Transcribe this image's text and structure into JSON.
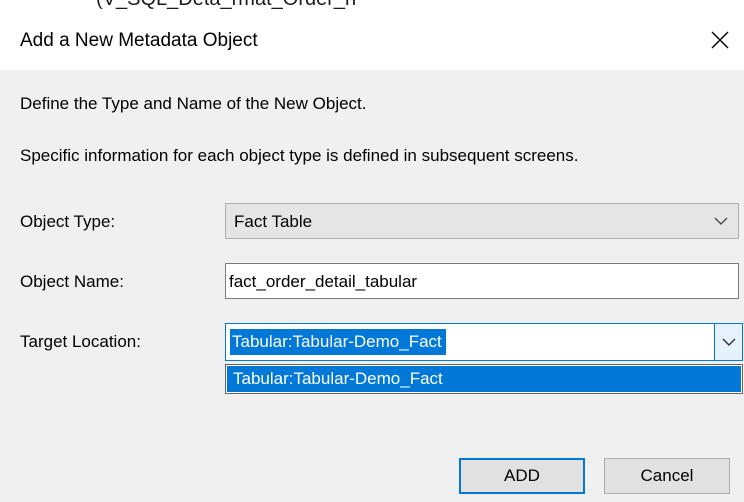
{
  "background_text": "(V_SQL_Deta_rmat_Order_n",
  "dialog": {
    "title": "Add a New Metadata Object",
    "close_symbol": "×",
    "intro_line_1": "Define the Type and Name of the New Object.",
    "intro_line_2": "Specific information for each object type is defined in subsequent screens."
  },
  "form": {
    "object_type": {
      "label": "Object Type:",
      "value": "Fact Table"
    },
    "object_name": {
      "label": "Object Name:",
      "value": "fact_order_detail_tabular"
    },
    "target_location": {
      "label": "Target Location:",
      "value": "Tabular:Tabular-Demo_Fact",
      "options": [
        "Tabular:Tabular-Demo_Fact"
      ]
    }
  },
  "buttons": {
    "add": "ADD",
    "cancel": "Cancel"
  },
  "colors": {
    "accent": "#0078d7",
    "dialog_bg": "#f0f0f0",
    "button_bg": "#e1e1e1"
  },
  "icons": [
    "close-icon",
    "chevron-down-icon"
  ]
}
